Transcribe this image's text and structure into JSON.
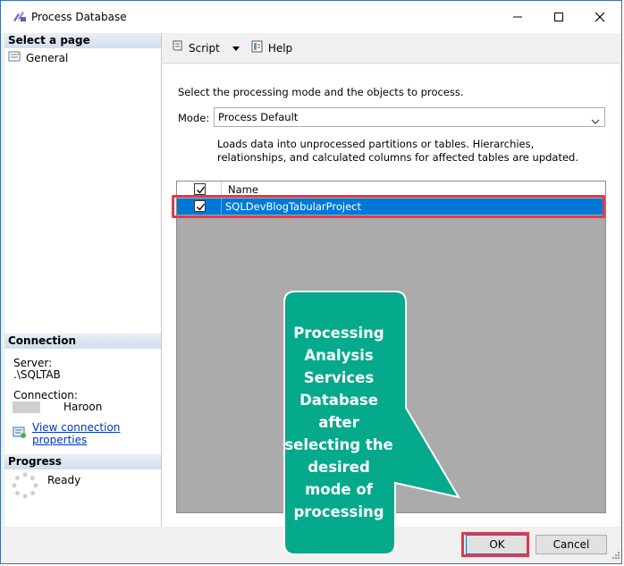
{
  "window": {
    "title": "Process Database",
    "controls": [
      "minimize",
      "maximize",
      "close"
    ]
  },
  "left": {
    "select_page_header": "Select a page",
    "pages": [
      {
        "label": "General",
        "icon": "properties-icon"
      }
    ],
    "connection_header": "Connection",
    "server_label": "Server:",
    "server_value": ".\\SQLTAB",
    "connection_label": "Connection:",
    "connection_value": "Haroon",
    "view_connection_link": "View connection properties",
    "progress_header": "Progress",
    "progress_status": "Ready"
  },
  "toolbar": {
    "script_label": "Script",
    "help_label": "Help"
  },
  "main": {
    "instruction": "Select the processing mode and the objects to process.",
    "mode_label": "Mode:",
    "mode_value": "Process Default",
    "mode_description": "Loads data into unprocessed partitions or tables. Hierarchies, relationships, and calculated columns for affected tables are updated.",
    "grid": {
      "column_header": "Name",
      "header_checked": true,
      "rows": [
        {
          "name": "SQLDevBlogTabularProject",
          "checked": true,
          "selected": true
        }
      ]
    }
  },
  "footer": {
    "ok_label": "OK",
    "cancel_label": "Cancel"
  },
  "annotation": {
    "callout_text": "Processing Analysis Services Database after selecting the desired mode of processing",
    "callout_color": "#05a98b",
    "highlight_color": "#e33a4a"
  },
  "colors": {
    "selection": "#0078d7",
    "link": "#0033cc",
    "window_border": "#3c6fb5"
  }
}
